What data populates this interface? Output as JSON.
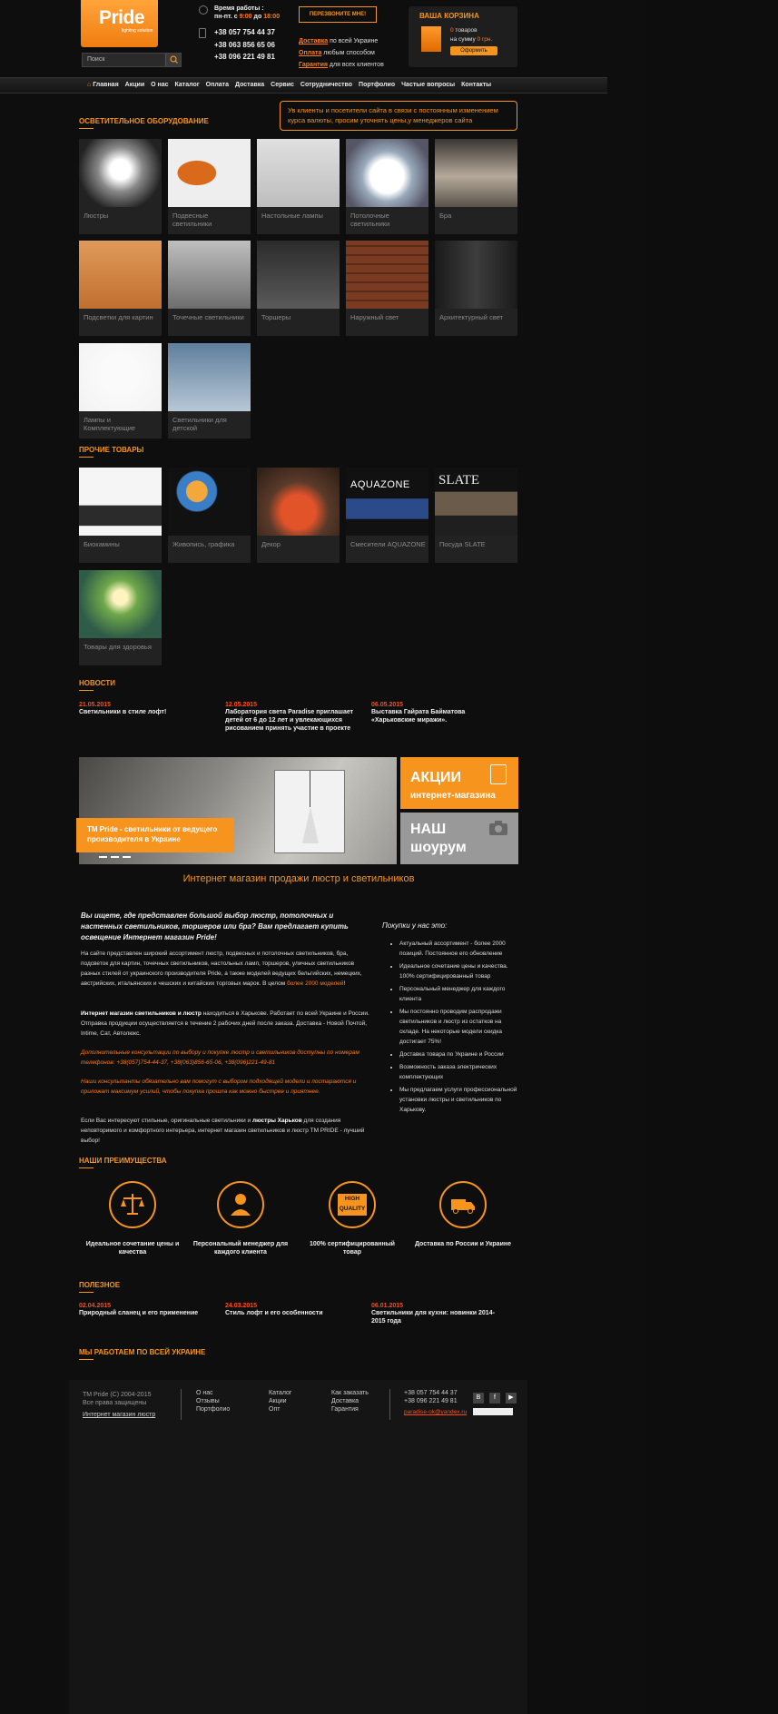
{
  "header": {
    "logo_text": "Pride",
    "logo_sub": "lighting solution",
    "search_placeholder": "Поиск",
    "hours_label": "Время работы :",
    "hours_value_pre": "пн-пт. с ",
    "hours_from": "9:00",
    "hours_mid": " до ",
    "hours_to": "18:00",
    "phones": [
      "+38 057 754 44 37",
      "+38 063 856 65 06",
      "+38 096 221 49 81"
    ],
    "call_button": "ПЕРЕЗВОНИТЕ МНЕ!",
    "links": [
      {
        "a": "Доставка",
        "rest": " по всей Украине"
      },
      {
        "a": "Оплата",
        "rest": " любым способом"
      },
      {
        "a": "Гарантия",
        "rest": " для всех клиентов"
      }
    ],
    "cart": {
      "title": "ВАША КОРЗИНА",
      "count": "0",
      "count_text": " товаров",
      "sum_text": "на сумму ",
      "sum": "0 грн.",
      "button": "Оформить"
    }
  },
  "nav": [
    "Главная",
    "Акции",
    "О нас",
    "Каталог",
    "Оплата",
    "Доставка",
    "Сервис",
    "Сотрудничество",
    "Портфолио",
    "Частые вопросы",
    "Контакты"
  ],
  "section_lighting": "ОСВЕТИТЕЛЬНОЕ ОБОРУДОВАНИЕ",
  "notice": "Ув клиенты и посетители сайта в связи с постоянным изменением курса валюты, просим уточнять цены,у менеджеров сайта",
  "lighting": [
    "Люстры",
    "Подвесные светильники",
    "Настольные лампы",
    "Потолочные светильники",
    "Бра",
    "Подсветки для картин",
    "Точечные светильники",
    "Торшеры",
    "Наружный свет",
    "Архитектурный свет",
    "Лампы и Комплектующие",
    "Светильники для детской"
  ],
  "section_other": "ПРОЧИЕ ТОВАРЫ",
  "other": [
    "Биокамины",
    "Живопись, графика",
    "Декор",
    "Смесители AQUAZONE",
    "Посуда SLATE",
    "Товары для здоровья"
  ],
  "tile_overlays": {
    "aquazone": "AQUAZONE",
    "slate": "SLATE"
  },
  "section_news": "НОВОСТИ",
  "news": [
    {
      "date": "21.05.2015",
      "title": "Светильники в стиле лофт!"
    },
    {
      "date": "12.05.2015",
      "title": "Лаборатория света Paradise приглашает детей от 6 до 12 лет и увлекающихся рисованием принять участие в проекте"
    },
    {
      "date": "06.05.2015",
      "title": "Выставка Гайрата Байматова «Харьковские миражи»."
    }
  ],
  "banner_caption": "TM Pride - светильники от ведущего производителя в Украине",
  "promo1": {
    "l1": "АКЦИИ",
    "l2": "интернет-магазина"
  },
  "promo2": {
    "l1": "НАШ",
    "l2": "шоурум"
  },
  "main_title": "Интернет магазин продажи люстр и светильников",
  "intro_italic": "Вы ищете, где представлен большой выбор люстр, потолочных и настенных светильников, торшеров или бра? Вам предлагает купить освещение Интернет магазин Pride!",
  "p1_a": "На сайте представлен широкий ассортимент люстр, подвесных и потолочных светильников, бра, подсветок для картин, точечных светильников, настольных ламп, торшеров, уличных светильников разных стилей от украинского производителя Pride, а также моделей ведущих бельгийских, немецких, австрийских, итальянских и чешских и китайских торговых марок.  В целом ",
  "p1_link": "более 2000 моделей",
  "p1_end": "!",
  "p2_bold": "Интернет магазин светильников и люстр",
  "p2_rest": " находиться в Харькове. Работает по всей Украине и России. Отправка продукции осуществляется в течение 2 рабочих дней после заказа. Доставка - Новой Почтой, Intime, Сат, Автолюкс.",
  "p3": "Дополнительные консультации по выбору и покупке люстр и светильников доступны по номерам телефонов: +38(057)754-44-37, +38(063)856-65-06, +38(096)221-49-81",
  "p4": "Наши консультанты обязательно вам помогут с выбором подходящей модели и постараются и приложат максимум усилий, чтобы покупка прошла как можно быстрее и приятнее.",
  "p5_a": "Если Вас интересуют стильные, оригинальные светильники и ",
  "p5_bold": "люстры Харьков",
  "p5_b": " для создания неповторимого и комфортного интерьера, интернет магазин светильников и люстр TM PRIDE - лучший выбор!",
  "why_title": "Покупки у нас это:",
  "why": [
    "Актуальный ассортимент - более 2000 позиций. Постоянное его обновление",
    "Идеальное сочетание цены и качества. 100% сертифицированный товар",
    "Персональный менеджер для каждого клиента",
    "Мы постоянно проводим распродажи светильников и люстр из остатков на складе. На некоторые модели скидка достигает 75%!",
    "Доставка товара по Украине и России",
    "Возможность заказа электрических комплектующих",
    "Мы предлагаем услуги профессиональной установки люстры и светильников по Харькову."
  ],
  "section_adv": "НАШИ ПРЕИМУЩЕСТВА",
  "advantages": [
    "Идеальное сочетание цены и качества",
    "Персональный менеджер для каждого клиента",
    "100% сертифицированный товар",
    "Доставка по России и Украине"
  ],
  "hq_badge": {
    "l1": "HIGH",
    "l2": "QUALITY"
  },
  "section_useful": "ПОЛЕЗНОЕ",
  "useful": [
    {
      "date": "02.04.2015",
      "title": "Природный сланец и его применение"
    },
    {
      "date": "24.03.2015",
      "title": "Стиль лофт и его особенности"
    },
    {
      "date": "06.01.2015",
      "title": "Светильники для кухни: новинки 2014-2015 года"
    }
  ],
  "section_ukraine": "МЫ РАБОТАЕМ ПО ВСЕЙ УКРАИНЕ",
  "footer": {
    "copy1": "TM Pride (C) 2004-2015",
    "copy2": "Все права защищены",
    "shop_link": "Интернет магазин люстр",
    "col1": [
      "О нас",
      "Отзывы",
      "Портфолио"
    ],
    "col2": [
      "Каталог",
      "Акции",
      "Опт"
    ],
    "col3": [
      "Как заказать",
      "Доставка",
      "Гарантия"
    ],
    "phones": [
      "+38 057 754 44 37",
      "+38 096 221 49 81"
    ],
    "email": "paradise-ok@yandex.ru",
    "social": [
      "В",
      "f",
      "▶"
    ]
  },
  "colors": {
    "accent": "#f7941d",
    "bg": "#0e0e0e",
    "date": "#ff4c1a"
  }
}
